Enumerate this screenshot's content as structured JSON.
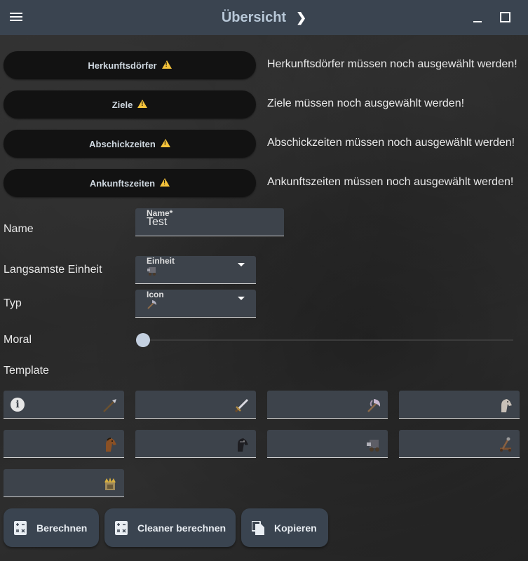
{
  "header": {
    "title": "Übersicht"
  },
  "status": [
    {
      "button": "Herkunftsdörfer",
      "message": "Herkunftsdörfer müssen noch ausgewählt werden!"
    },
    {
      "button": "Ziele",
      "message": "Ziele müssen noch ausgewählt werden!"
    },
    {
      "button": "Abschickzeiten",
      "message": "Abschickzeiten müssen noch ausgewählt werden!"
    },
    {
      "button": "Ankunftszeiten",
      "message": "Ankunftszeiten müssen noch ausgewählt werden!"
    }
  ],
  "form": {
    "name_label": "Name",
    "name_field_label": "Name*",
    "name_value": "Test",
    "unit_label": "Langsamste Einheit",
    "unit_field_label": "Einheit",
    "unit_icon": "ram-icon",
    "type_label": "Typ",
    "type_field_label": "Icon",
    "type_icon": "axe-icon",
    "moral_label": "Moral",
    "moral_value": 0,
    "template_label": "Template"
  },
  "template": [
    {
      "icon": "spear-icon"
    },
    {
      "icon": "sword-icon"
    },
    {
      "icon": "axe-icon"
    },
    {
      "icon": "scout-horse-icon"
    },
    {
      "icon": "light-cavalry-icon"
    },
    {
      "icon": "heavy-cavalry-icon"
    },
    {
      "icon": "ram-icon"
    },
    {
      "icon": "catapult-icon"
    },
    {
      "icon": "noble-icon"
    }
  ],
  "actions": {
    "calculate": "Berechnen",
    "clean_calculate": "Cleaner berechnen",
    "copy": "Kopieren"
  },
  "colors": {
    "topbar": "#3a4450",
    "warning": "#f5c33b",
    "field": "#3d434b"
  }
}
